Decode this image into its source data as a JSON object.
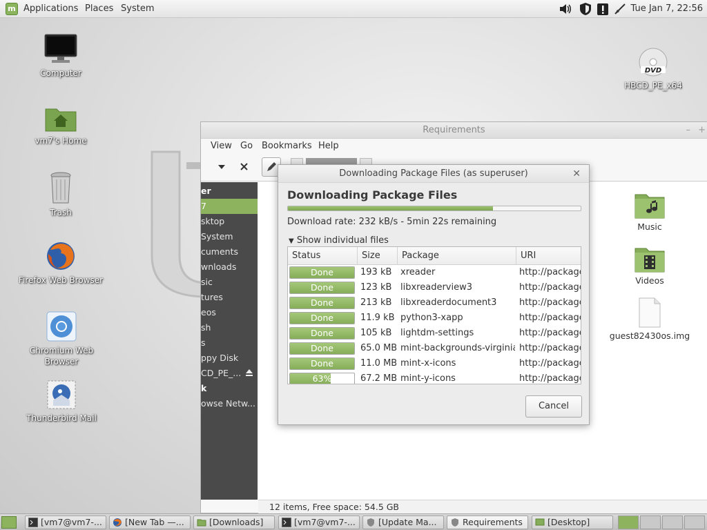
{
  "top_panel": {
    "menus": [
      "Applications",
      "Places",
      "System"
    ],
    "clock": "Tue Jan  7, 22:56"
  },
  "desktop": {
    "icons": [
      {
        "label": "Computer",
        "icon": "monitor-icon"
      },
      {
        "label": "vm7's Home",
        "icon": "home-folder-icon"
      },
      {
        "label": "Trash",
        "icon": "trash-icon"
      },
      {
        "label": "Firefox Web Browser",
        "icon": "firefox-icon"
      },
      {
        "label": "Chromium Web Browser",
        "icon": "chromium-icon"
      },
      {
        "label": "Thunderbird Mail",
        "icon": "thunderbird-icon"
      },
      {
        "label": "HBCD_PE_x64",
        "icon": "dvd-icon"
      }
    ]
  },
  "file_manager": {
    "title": "Requirements",
    "menus": [
      "View",
      "Go",
      "Bookmarks",
      "Help"
    ],
    "sidebar": [
      {
        "label": "er",
        "type": "heading"
      },
      {
        "label": "7",
        "type": "active"
      },
      {
        "label": "sktop",
        "type": "item"
      },
      {
        "label": "System",
        "type": "item"
      },
      {
        "label": "cuments",
        "type": "item"
      },
      {
        "label": "wnloads",
        "type": "item"
      },
      {
        "label": "sic",
        "type": "item"
      },
      {
        "label": "tures",
        "type": "item"
      },
      {
        "label": "eos",
        "type": "item"
      },
      {
        "label": "sh",
        "type": "item"
      },
      {
        "label": "s",
        "type": "item"
      },
      {
        "label": "ppy Disk",
        "type": "item"
      },
      {
        "label": "CD_PE_...",
        "type": "item"
      },
      {
        "label": "k",
        "type": "heading"
      },
      {
        "label": "owse Netw...",
        "type": "item"
      }
    ],
    "files": [
      {
        "label": "Music",
        "icon": "music-folder-icon"
      },
      {
        "label": "Videos",
        "icon": "videos-folder-icon"
      },
      {
        "label": "guest82430os.img",
        "icon": "file-icon"
      }
    ],
    "status": "12 items, Free space: 54.5 GB"
  },
  "dialog": {
    "title": "Downloading Package Files (as superuser)",
    "heading": "Downloading Package Files",
    "overall_progress": 0.7,
    "rate": "Download rate: 232 kB/s - 5min 22s remaining",
    "expander": "Show individual files",
    "columns": [
      "Status",
      "Size",
      "Package",
      "URI"
    ],
    "rows": [
      {
        "status": "Done",
        "progress": 1.0,
        "size": "193 kB",
        "package": "xreader",
        "uri": "http://package"
      },
      {
        "status": "Done",
        "progress": 1.0,
        "size": "123 kB",
        "package": "libxreaderview3",
        "uri": "http://package"
      },
      {
        "status": "Done",
        "progress": 1.0,
        "size": "213 kB",
        "package": "libxreaderdocument3",
        "uri": "http://package"
      },
      {
        "status": "Done",
        "progress": 1.0,
        "size": "11.9 kB",
        "package": "python3-xapp",
        "uri": "http://package"
      },
      {
        "status": "Done",
        "progress": 1.0,
        "size": "105 kB",
        "package": "lightdm-settings",
        "uri": "http://package"
      },
      {
        "status": "Done",
        "progress": 1.0,
        "size": "65.0 MB",
        "package": "mint-backgrounds-virginia",
        "uri": "http://package"
      },
      {
        "status": "Done",
        "progress": 1.0,
        "size": "11.0 MB",
        "package": "mint-x-icons",
        "uri": "http://package"
      },
      {
        "status": "63%",
        "progress": 0.63,
        "size": "67.2 MB",
        "package": "mint-y-icons",
        "uri": "http://package"
      }
    ],
    "cancel_label": "Cancel"
  },
  "taskbar": {
    "tasks": [
      {
        "label": "[vm7@vm7-...",
        "icon": "terminal-icon",
        "active": false
      },
      {
        "label": "[New Tab —...",
        "icon": "firefox-icon",
        "active": false
      },
      {
        "label": "[Downloads]",
        "icon": "folder-icon",
        "active": false
      },
      {
        "label": "[vm7@vm7-...",
        "icon": "terminal-icon",
        "active": false
      },
      {
        "label": "[Update Ma...",
        "icon": "shield-icon",
        "active": false
      },
      {
        "label": "Requirements",
        "icon": "shield-icon",
        "active": true
      },
      {
        "label": "[Desktop]",
        "icon": "desktop-icon",
        "active": false
      }
    ]
  }
}
